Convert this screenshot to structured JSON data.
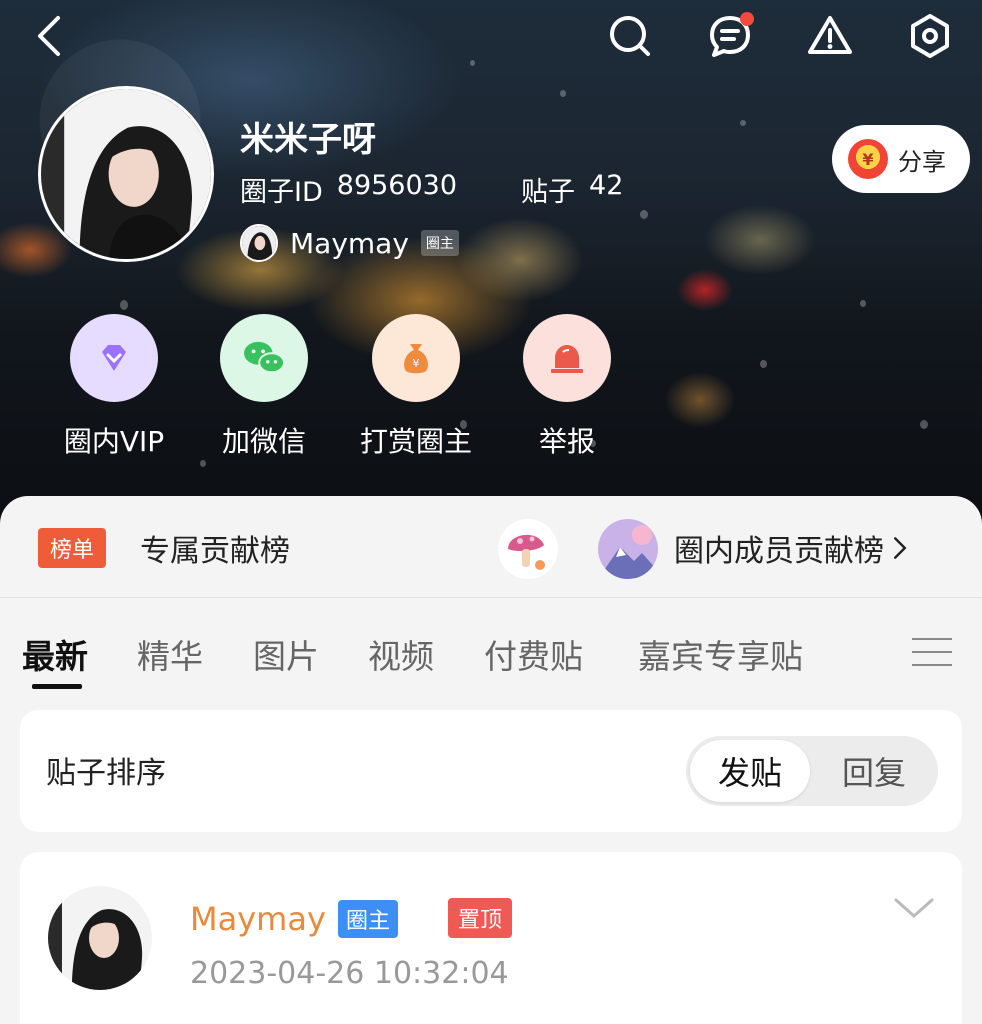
{
  "header": {
    "icons": [
      "back-icon",
      "search-icon",
      "message-icon",
      "warning-icon",
      "settings-icon"
    ]
  },
  "profile": {
    "name": "米米子呀",
    "id_label": "圈子ID",
    "id_value": "8956030",
    "posts_label": "贴子",
    "posts_value": "42",
    "owner_name": "Maymay",
    "owner_tag": "圈主"
  },
  "share": {
    "label": "分享",
    "coin_symbol": "¥"
  },
  "actions": [
    {
      "label": "圈内VIP",
      "icon": "vip-diamond-icon",
      "bg": "#e6dcff",
      "fg": "#9b72ff"
    },
    {
      "label": "加微信",
      "icon": "wechat-icon",
      "bg": "#ddf7e6",
      "fg": "#39c15f"
    },
    {
      "label": "打赏圈主",
      "icon": "money-bag-icon",
      "bg": "#fde7d6",
      "fg": "#f08a3e"
    },
    {
      "label": "举报",
      "icon": "alarm-icon",
      "bg": "#fbe0dc",
      "fg": "#ea5a4a"
    }
  ],
  "ranking": {
    "tag": "榜单",
    "title": "专属贡献榜",
    "link": "圈内成员贡献榜"
  },
  "tabs": [
    "最新",
    "精华",
    "图片",
    "视频",
    "付费贴",
    "嘉宾专享贴"
  ],
  "sort": {
    "label": "贴子排序",
    "options": [
      "发贴",
      "回复"
    ],
    "selected": "发贴"
  },
  "post": {
    "author": "Maymay",
    "role": "圈主",
    "pin": "置顶",
    "time": "2023-04-26 10:32:04"
  },
  "colors": {
    "accent_orange": "#e88a3c",
    "rank_tag": "#ee5c3a",
    "role_blue": "#3d8ff3",
    "pin_red": "#ef5a55",
    "notification_dot": "#f04b3c"
  }
}
